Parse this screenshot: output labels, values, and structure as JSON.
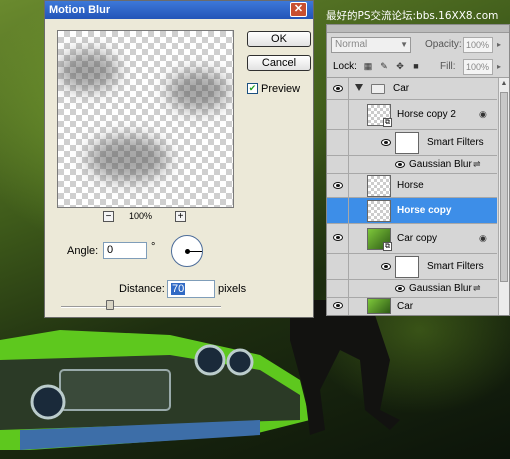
{
  "watermark": "最好的PS交流论坛:bbs.16XX8.com",
  "dialog": {
    "title": "Motion Blur",
    "close_glyph": "✕",
    "ok_label": "OK",
    "cancel_label": "Cancel",
    "preview_label": "Preview",
    "preview_checked": true,
    "zoom_out": "−",
    "zoom_in": "+",
    "zoom_level": "100%",
    "angle_label": "Angle:",
    "angle_value": "0",
    "degree_sign": "°",
    "distance_label": "Distance:",
    "distance_value": "70",
    "distance_unit": "pixels"
  },
  "layers_panel": {
    "blend_mode": "Normal",
    "opacity_label": "Opacity:",
    "opacity_value": "100%",
    "lock_label": "Lock:",
    "fill_label": "Fill:",
    "fill_value": "100%",
    "layers": [
      {
        "name": "Car",
        "type": "group"
      },
      {
        "name": "Horse copy 2",
        "type": "smart-object"
      },
      {
        "name": "Smart Filters",
        "type": "filter-mask"
      },
      {
        "name": "Gaussian Blur",
        "type": "filter"
      },
      {
        "name": "Horse",
        "type": "layer"
      },
      {
        "name": "Horse copy",
        "type": "layer",
        "selected": true
      },
      {
        "name": "Car copy",
        "type": "smart-object"
      },
      {
        "name": "Smart Filters",
        "type": "filter-mask"
      },
      {
        "name": "Gaussian Blur",
        "type": "filter"
      },
      {
        "name": "Car",
        "type": "layer"
      }
    ]
  },
  "colors": {
    "selection_blue": "#3d8ee8",
    "dialog_bg": "#ece9d8",
    "titlebar_blue": "#2354b8"
  }
}
